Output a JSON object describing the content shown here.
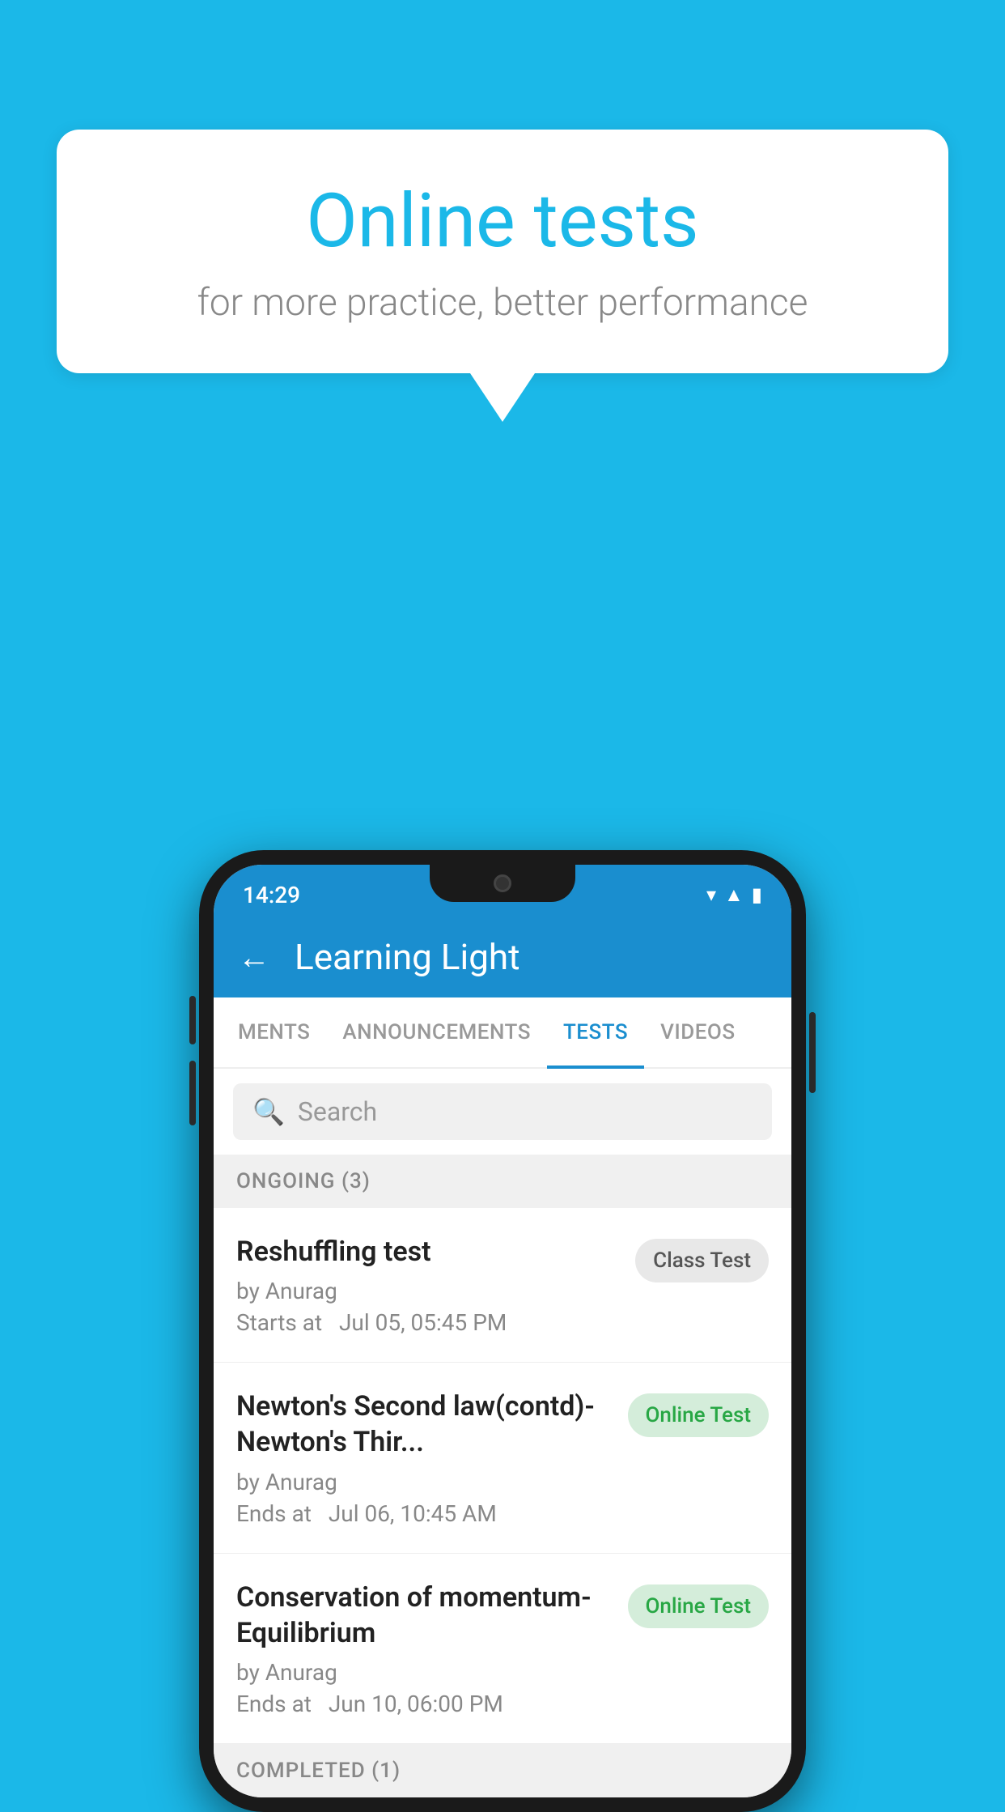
{
  "background": {
    "color": "#1BB8E8"
  },
  "speech_bubble": {
    "title": "Online tests",
    "subtitle": "for more practice, better performance"
  },
  "phone": {
    "status_bar": {
      "time": "14:29",
      "icons": [
        "wifi",
        "signal",
        "battery"
      ]
    },
    "header": {
      "back_label": "←",
      "title": "Learning Light"
    },
    "tabs": [
      {
        "label": "MENTS",
        "active": false
      },
      {
        "label": "ANNOUNCEMENTS",
        "active": false
      },
      {
        "label": "TESTS",
        "active": true
      },
      {
        "label": "VIDEOS",
        "active": false
      }
    ],
    "search": {
      "placeholder": "Search"
    },
    "ongoing_section": {
      "label": "ONGOING (3)"
    },
    "tests": [
      {
        "name": "Reshuffling test",
        "author": "by Anurag",
        "time_label": "Starts at",
        "time": "Jul 05, 05:45 PM",
        "badge": "Class Test",
        "badge_type": "class"
      },
      {
        "name": "Newton's Second law(contd)-Newton's Thir...",
        "author": "by Anurag",
        "time_label": "Ends at",
        "time": "Jul 06, 10:45 AM",
        "badge": "Online Test",
        "badge_type": "online"
      },
      {
        "name": "Conservation of momentum-Equilibrium",
        "author": "by Anurag",
        "time_label": "Ends at",
        "time": "Jun 10, 06:00 PM",
        "badge": "Online Test",
        "badge_type": "online"
      }
    ],
    "completed_section": {
      "label": "COMPLETED (1)"
    }
  }
}
